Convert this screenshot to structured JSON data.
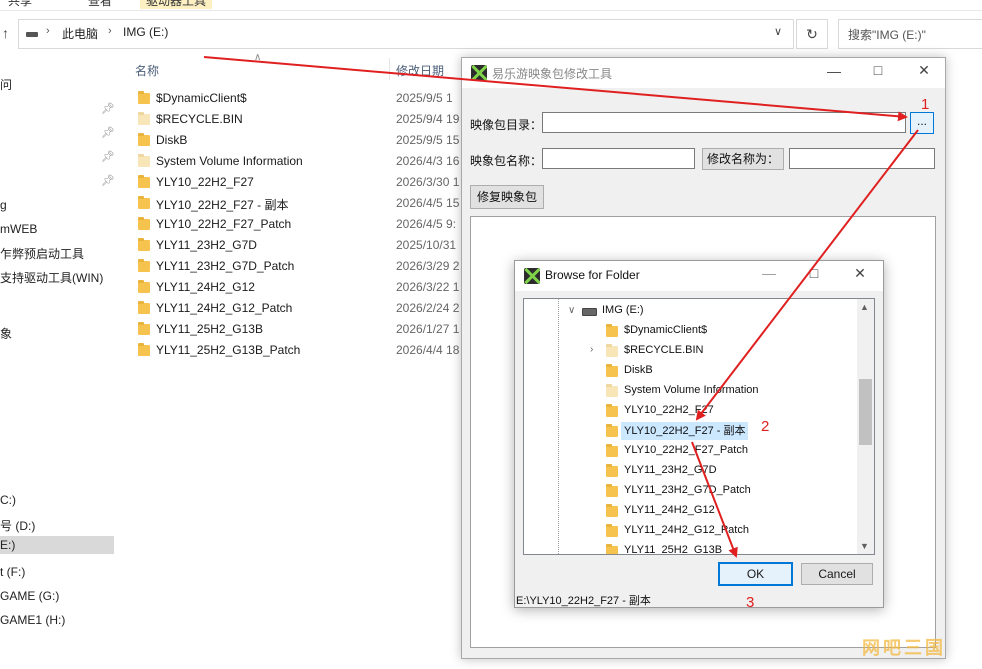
{
  "explorer": {
    "ribbon_tabs": [
      "共享",
      "查看",
      "驱动器工具"
    ],
    "breadcrumb": [
      "此电脑",
      "IMG (E:)"
    ],
    "search_placeholder": "搜索\"IMG (E:)\"",
    "columns": {
      "name": "名称",
      "date": "修改日期"
    },
    "nav_items": [
      {
        "label": "问"
      },
      {
        "label": "g"
      },
      {
        "label": "mWEB"
      },
      {
        "label": "乍弊预启动工具"
      },
      {
        "label": "支持驱动工具(WIN)"
      },
      {
        "label": "象"
      },
      {
        "label": "C:)"
      },
      {
        "label": "号 (D:)"
      },
      {
        "label": "E:)",
        "selected": true
      },
      {
        "label": "t (F:)"
      },
      {
        "label": "GAME (G:)"
      },
      {
        "label": "GAME1 (H:)"
      }
    ],
    "files": [
      {
        "name": "$DynamicClient$",
        "date": "2025/9/5 1",
        "pale": false
      },
      {
        "name": "$RECYCLE.BIN",
        "date": "2025/9/4 19",
        "pale": true
      },
      {
        "name": "DiskB",
        "date": "2025/9/5 15",
        "pale": false
      },
      {
        "name": "System Volume Information",
        "date": "2026/4/3 16",
        "pale": true
      },
      {
        "name": "YLY10_22H2_F27",
        "date": "2026/3/30 1",
        "pale": false
      },
      {
        "name": "YLY10_22H2_F27 - 副本",
        "date": "2026/4/5 15",
        "pale": false
      },
      {
        "name": "YLY10_22H2_F27_Patch",
        "date": "2026/4/5 9:",
        "pale": false
      },
      {
        "name": "YLY11_23H2_G7D",
        "date": "2025/10/31",
        "pale": false
      },
      {
        "name": "YLY11_23H2_G7D_Patch",
        "date": "2026/3/29 2",
        "pale": false
      },
      {
        "name": "YLY11_24H2_G12",
        "date": "2026/3/22 1",
        "pale": false
      },
      {
        "name": "YLY11_24H2_G12_Patch",
        "date": "2026/2/24 2",
        "pale": false
      },
      {
        "name": "YLY11_25H2_G13B",
        "date": "2026/1/27 1",
        "pale": false
      },
      {
        "name": "YLY11_25H2_G13B_Patch",
        "date": "2026/4/4 18",
        "pale": false
      }
    ]
  },
  "tool": {
    "title": "易乐游映象包修改工具",
    "dir_label": "映像包目录：",
    "dir_value": "",
    "browse_label": "...",
    "name_label": "映象包名称：",
    "name_value": "",
    "rename_button": "修改名称为：",
    "rename_value": "",
    "repair_button": "修复映象包"
  },
  "dialog": {
    "title": "Browse for Folder",
    "drive_label": "IMG (E:)",
    "tree_items": [
      {
        "label": "$DynamicClient$",
        "pale": false,
        "expander": false,
        "selected": false
      },
      {
        "label": "$RECYCLE.BIN",
        "pale": true,
        "expander": true,
        "selected": false
      },
      {
        "label": "DiskB",
        "pale": false,
        "expander": false,
        "selected": false
      },
      {
        "label": "System Volume Information",
        "pale": true,
        "expander": false,
        "selected": false
      },
      {
        "label": "YLY10_22H2_F27",
        "pale": false,
        "expander": false,
        "selected": false
      },
      {
        "label": "YLY10_22H2_F27 - 副本",
        "pale": false,
        "expander": false,
        "selected": true
      },
      {
        "label": "YLY10_22H2_F27_Patch",
        "pale": false,
        "expander": false,
        "selected": false
      },
      {
        "label": "YLY11_23H2_G7D",
        "pale": false,
        "expander": false,
        "selected": false
      },
      {
        "label": "YLY11_23H2_G7D_Patch",
        "pale": false,
        "expander": false,
        "selected": false
      },
      {
        "label": "YLY11_24H2_G12",
        "pale": false,
        "expander": false,
        "selected": false
      },
      {
        "label": "YLY11_24H2_G12_Patch",
        "pale": false,
        "expander": false,
        "selected": false
      },
      {
        "label": "YLY11_25H2_G13B",
        "pale": false,
        "expander": false,
        "selected": false
      }
    ],
    "ok_label": "OK",
    "cancel_label": "Cancel",
    "status_path": "E:\\YLY10_22H2_F27 - 副本"
  },
  "annotations": {
    "step1": "1",
    "step2": "2",
    "step3": "3",
    "arrow_color": "#e02020"
  },
  "watermark": "网吧三国"
}
